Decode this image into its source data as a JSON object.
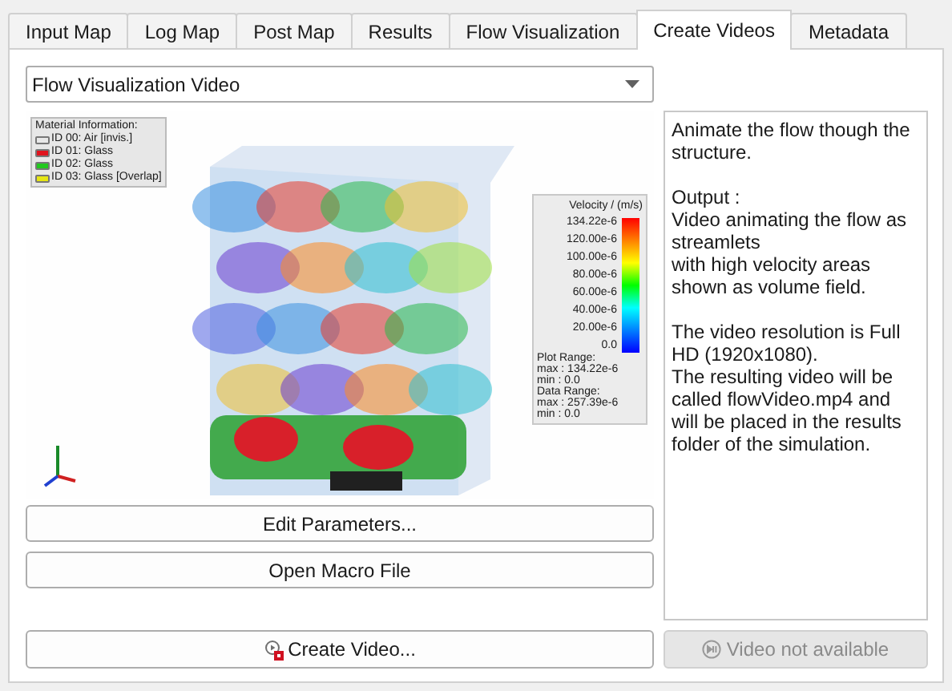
{
  "tabs": [
    {
      "label": "Input Map",
      "selected": false
    },
    {
      "label": "Log Map",
      "selected": false
    },
    {
      "label": "Post Map",
      "selected": false
    },
    {
      "label": "Results",
      "selected": false
    },
    {
      "label": "Flow Visualization",
      "selected": false
    },
    {
      "label": "Create Videos",
      "selected": true
    },
    {
      "label": "Metadata",
      "selected": false
    }
  ],
  "video_type": {
    "value": "Flow Visualization Video"
  },
  "viewer": {
    "kind": "picture",
    "material_legend": {
      "title": "Material Information:",
      "items": [
        {
          "label": "ID 00: Air [invis.]",
          "color": "#e8e8e8"
        },
        {
          "label": "ID 01: Glass",
          "color": "#e0141e"
        },
        {
          "label": "ID 02: Glass",
          "color": "#22c81e"
        },
        {
          "label": "ID 03: Glass [Overlap]",
          "color": "#e6e614"
        }
      ]
    },
    "velocity_legend": {
      "title": "Velocity / (m/s)",
      "ticks": [
        "134.22e-6",
        "120.00e-6",
        "100.00e-6",
        "80.00e-6",
        "60.00e-6",
        "40.00e-6",
        "20.00e-6",
        "0.0"
      ],
      "ranges": [
        "Plot Range:",
        "max : 134.22e-6",
        "min : 0.0",
        "Data Range:",
        "max : 257.39e-6",
        "min : 0.0"
      ]
    }
  },
  "buttons": [
    {
      "label": "Edit Parameters..."
    },
    {
      "label": "Open Macro File"
    }
  ],
  "description": [
    [
      "Animate the flow though the",
      "structure."
    ],
    [
      "Output :",
      "Video animating the flow as",
      "streamlets",
      "with high velocity areas",
      "shown as volume field."
    ],
    [
      "The video resolution is Full",
      "HD (1920x1080).",
      "The resulting video will be",
      "called flowVideo.mp4 and",
      "will be placed in the results",
      "folder of the simulation."
    ]
  ],
  "create_button": {
    "label": "Create Video...",
    "disabled": false
  },
  "play_button": {
    "label": "Video not available",
    "disabled": true
  }
}
